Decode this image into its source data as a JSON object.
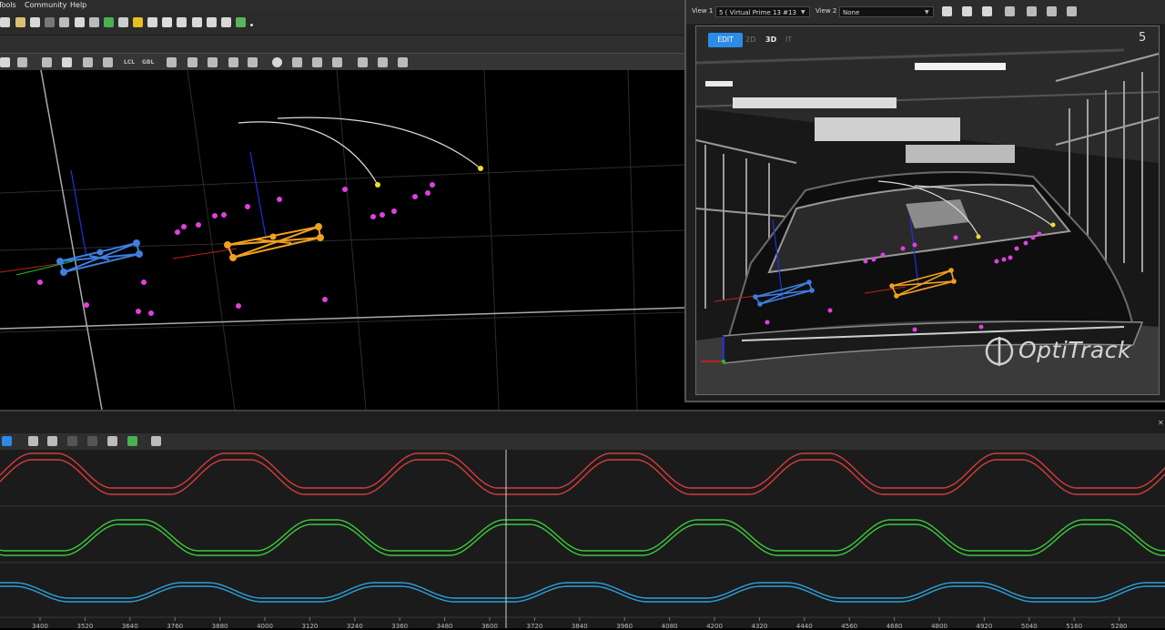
{
  "menu": [
    "Tools",
    "Community",
    "Help"
  ],
  "camera_view": {
    "view1_label": "View 1",
    "view1_value": "5  ( Virtual Prime 13 #13",
    "view2_label": "View 2",
    "view2_value": "None",
    "modes": [
      "EDIT",
      "2D",
      "3D",
      "IT"
    ],
    "camera_number": "5",
    "watermark": "OptiTrack"
  },
  "toolbar2": {
    "lcl": "LCL",
    "gbl": "GBL"
  },
  "timeline": {
    "ticks": [
      "3400",
      "3520",
      "3640",
      "3760",
      "3880",
      "4000",
      "3120",
      "3240",
      "3360",
      "3480",
      "3600",
      "3720",
      "3840",
      "3960",
      "4080",
      "4200",
      "4320",
      "4440",
      "4560",
      "4680",
      "4800",
      "4920",
      "5040",
      "5160",
      "5280"
    ]
  },
  "colors": {
    "rigid_body_1": "#3d7fe0",
    "rigid_body_2": "#f0a020",
    "markers": "#e040e0",
    "accent": "#2b8ce8",
    "curve_x": "#d43c3c",
    "curve_y": "#3cc83c",
    "curve_z": "#2da0d8"
  }
}
